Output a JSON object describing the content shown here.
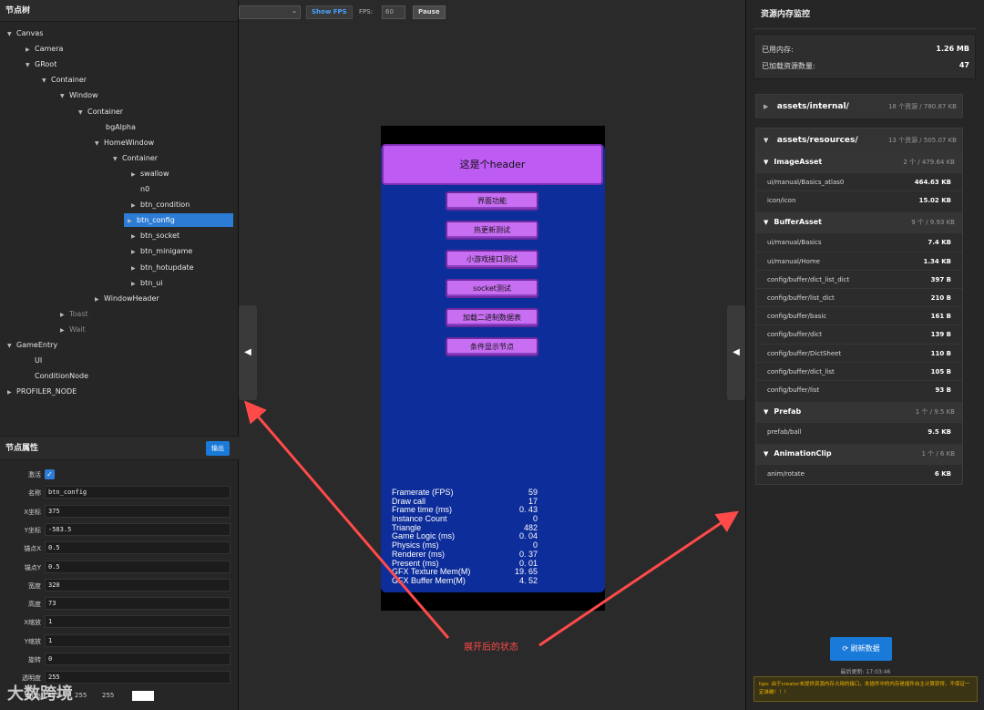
{
  "left_panel": {
    "tree_title": "节点树",
    "tree": [
      {
        "label": "Canvas",
        "arrow": "▼",
        "dim": false,
        "selected": false
      },
      {
        "label": "Camera",
        "arrow": "▶",
        "dim": false,
        "selected": false
      },
      {
        "label": "GRoot",
        "arrow": "▼",
        "dim": false,
        "selected": false
      },
      {
        "label": "Container",
        "arrow": "▼",
        "dim": false,
        "selected": false
      },
      {
        "label": "Window",
        "arrow": "▼",
        "dim": false,
        "selected": false
      },
      {
        "label": "Container",
        "arrow": "▼",
        "dim": false,
        "selected": false
      },
      {
        "label": "bgAlpha",
        "arrow": "",
        "dim": false,
        "selected": false
      },
      {
        "label": "HomeWindow",
        "arrow": "▼",
        "dim": false,
        "selected": false
      },
      {
        "label": "Container",
        "arrow": "▼",
        "dim": false,
        "selected": false
      },
      {
        "label": "swallow",
        "arrow": "▶",
        "dim": false,
        "selected": false
      },
      {
        "label": "n0",
        "arrow": "",
        "dim": false,
        "selected": false
      },
      {
        "label": "btn_condition",
        "arrow": "▶",
        "dim": false,
        "selected": false
      },
      {
        "label": "btn_config",
        "arrow": "▶",
        "dim": false,
        "selected": true
      },
      {
        "label": "btn_socket",
        "arrow": "▶",
        "dim": false,
        "selected": false
      },
      {
        "label": "btn_minigame",
        "arrow": "▶",
        "dim": false,
        "selected": false
      },
      {
        "label": "btn_hotupdate",
        "arrow": "▶",
        "dim": false,
        "selected": false
      },
      {
        "label": "btn_ui",
        "arrow": "▶",
        "dim": false,
        "selected": false
      },
      {
        "label": "WindowHeader",
        "arrow": "▶",
        "dim": false,
        "selected": false
      },
      {
        "label": "Toast",
        "arrow": "▶",
        "dim": true,
        "selected": false
      },
      {
        "label": "Wait",
        "arrow": "▶",
        "dim": true,
        "selected": false
      },
      {
        "label": "GameEntry",
        "arrow": "▼",
        "dim": false,
        "selected": false
      },
      {
        "label": "UI",
        "arrow": "",
        "dim": false,
        "selected": false
      },
      {
        "label": "ConditionNode",
        "arrow": "",
        "dim": false,
        "selected": false
      },
      {
        "label": "PROFILER_NODE",
        "arrow": "▶",
        "dim": false,
        "selected": false
      }
    ],
    "props_title": "节点属性",
    "export_label": "输出",
    "props": [
      {
        "label": "激活",
        "value": "",
        "checkbox": true
      },
      {
        "label": "名称",
        "value": "btn_config"
      },
      {
        "label": "X坐标",
        "value": "375"
      },
      {
        "label": "Y坐标",
        "value": "-583.5"
      },
      {
        "label": "锚点X",
        "value": "0.5"
      },
      {
        "label": "锚点Y",
        "value": "0.5"
      },
      {
        "label": "宽度",
        "value": "320"
      },
      {
        "label": "高度",
        "value": "73"
      },
      {
        "label": "X缩放",
        "value": "1"
      },
      {
        "label": "Y缩放",
        "value": "1"
      },
      {
        "label": "旋转",
        "value": "0"
      },
      {
        "label": "透明度",
        "value": "255"
      }
    ],
    "color_label": "RGB",
    "color_values": [
      "255",
      "255",
      "255"
    ]
  },
  "toolbar": {
    "show_fps": "Show FPS",
    "fps_label": "FPS:",
    "fps_value": "60",
    "pause": "Pause"
  },
  "preview": {
    "header": "这是个header",
    "buttons": [
      "界面功能",
      "热更新测试",
      "小游戏接口测试",
      "socket测试",
      "加载二进制数据表",
      "条件显示节点"
    ],
    "stats": [
      {
        "k": "Framerate (FPS)",
        "v": "59"
      },
      {
        "k": "Draw call",
        "v": "17"
      },
      {
        "k": "Frame time (ms)",
        "v": "0. 43"
      },
      {
        "k": "Instance Count",
        "v": "0"
      },
      {
        "k": "Triangle",
        "v": "482"
      },
      {
        "k": "Game Logic (ms)",
        "v": "0. 04"
      },
      {
        "k": "Physics (ms)",
        "v": "0"
      },
      {
        "k": "Renderer (ms)",
        "v": "0. 37"
      },
      {
        "k": "Present (ms)",
        "v": "0. 01"
      },
      {
        "k": "GFX Texture Mem(M)",
        "v": "19. 65"
      },
      {
        "k": "GFX Buffer Mem(M)",
        "v": "4. 52"
      }
    ]
  },
  "annotation": {
    "caption": "展开后的状态"
  },
  "watermark": "大数跨境",
  "right_panel": {
    "title": "资源内存监控",
    "used_label": "已用内存:",
    "used_value": "1.26 MB",
    "count_label": "已加载资源数量:",
    "count_value": "47",
    "internal": {
      "name": "assets/internal/",
      "meta": "18 个资源 / 780.87 KB"
    },
    "resources": {
      "name": "assets/resources/",
      "meta": "13 个资源 / 505.07 KB"
    },
    "groups": [
      {
        "name": "ImageAsset",
        "meta": "2 个 / 479.64 KB",
        "items": [
          {
            "path": "ui/manual/Basics_atlas0",
            "size": "464.63 KB"
          },
          {
            "path": "icon/icon",
            "size": "15.02 KB"
          }
        ]
      },
      {
        "name": "BufferAsset",
        "meta": "9 个 / 9.93 KB",
        "items": [
          {
            "path": "ui/manual/Basics",
            "size": "7.4 KB"
          },
          {
            "path": "ui/manual/Home",
            "size": "1.34 KB"
          },
          {
            "path": "config/buffer/dict_list_dict",
            "size": "397 B"
          },
          {
            "path": "config/buffer/list_dict",
            "size": "210 B"
          },
          {
            "path": "config/buffer/basic",
            "size": "161 B"
          },
          {
            "path": "config/buffer/dict",
            "size": "139 B"
          },
          {
            "path": "config/buffer/DictSheet",
            "size": "110 B"
          },
          {
            "path": "config/buffer/dict_list",
            "size": "105 B"
          },
          {
            "path": "config/buffer/list",
            "size": "93 B"
          }
        ]
      },
      {
        "name": "Prefab",
        "meta": "1 个 / 9.5 KB",
        "items": [
          {
            "path": "prefab/ball",
            "size": "9.5 KB"
          }
        ]
      },
      {
        "name": "AnimationClip",
        "meta": "1 个 / 6 KB",
        "items": [
          {
            "path": "anim/rotate",
            "size": "6 KB"
          }
        ]
      }
    ],
    "refresh_label": "刷新数据",
    "last_update": "最后更新: 17:03:46",
    "tips": "tips: 由于creator未提供资源内存占用的接口，本插件中的内存是插件自主计算获得，不保证一定准确！！！"
  },
  "colors": {
    "accent": "#1a7ad9",
    "selected": "#2c7cd6",
    "game_bg": "#0d2d9a",
    "game_button": "#c76ef2",
    "arrow": "#ff4a4a"
  }
}
